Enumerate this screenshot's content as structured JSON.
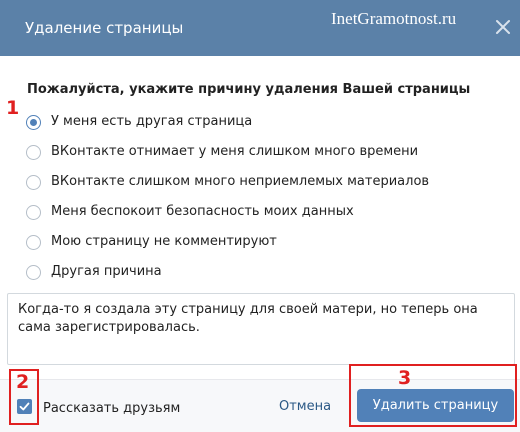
{
  "dialog": {
    "title": "Удаление страницы",
    "watermark": "InetGramotnost.ru",
    "close_icon": "close-icon"
  },
  "form": {
    "question": "Пожалуйста, укажите причину удаления Вашей страницы",
    "options": [
      {
        "label": "У меня есть другая страница",
        "selected": true
      },
      {
        "label": "ВКонтакте отнимает у меня слишком много времени",
        "selected": false
      },
      {
        "label": "ВКонтакте слишком много неприемлемых материалов",
        "selected": false
      },
      {
        "label": "Меня беспокоит безопасность моих данных",
        "selected": false
      },
      {
        "label": "Мою страницу не комментируют",
        "selected": false
      },
      {
        "label": "Другая причина",
        "selected": false
      }
    ],
    "comment": "Когда-то я создала эту страницу для своей матери, но теперь она сама зарегистрировалась."
  },
  "footer": {
    "tell_friends_label": "Рассказать друзьям",
    "tell_friends_checked": true,
    "cancel_label": "Отмена",
    "delete_label": "Удалить страницу"
  },
  "annotations": {
    "marker_1": "1",
    "marker_2": "2",
    "marker_3": "3"
  },
  "colors": {
    "header": "#5b81a8",
    "accent": "#5181b8",
    "link": "#2a5885",
    "annotation": "#e02020",
    "footer_bg": "#f7f8fa"
  }
}
